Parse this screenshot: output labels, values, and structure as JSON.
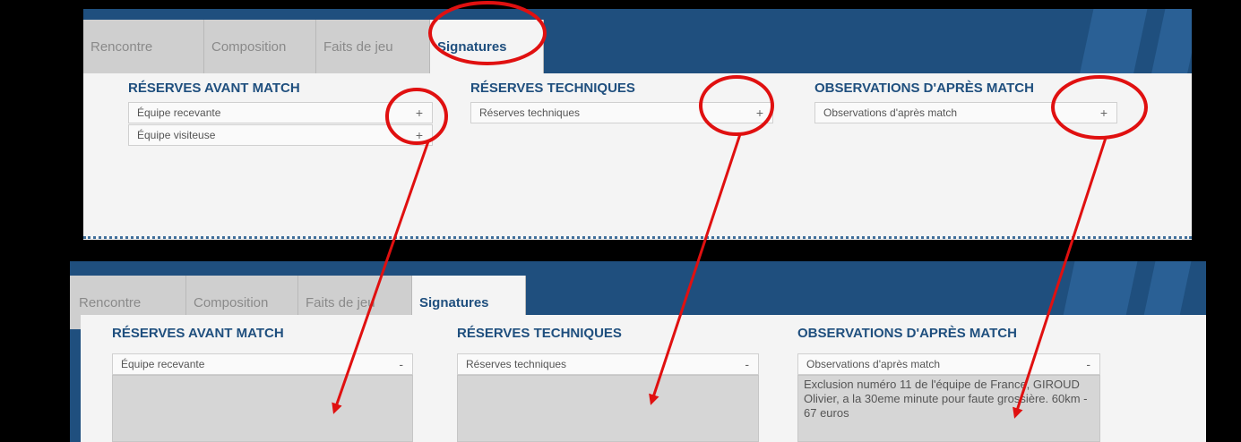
{
  "top": {
    "tabs": [
      "Rencontre",
      "Composition",
      "Faits de jeu",
      "Signatures"
    ],
    "sections": {
      "reserves_avant": {
        "title": "RÉSERVES AVANT MATCH",
        "rows": [
          {
            "label": "Équipe recevante",
            "toggle": "+"
          },
          {
            "label": "Équipe visiteuse",
            "toggle": "+"
          }
        ]
      },
      "reserves_tech": {
        "title": "RÉSERVES TECHNIQUES",
        "rows": [
          {
            "label": "Réserves techniques",
            "toggle": "+"
          }
        ]
      },
      "observations": {
        "title": "OBSERVATIONS D'APRÈS MATCH",
        "rows": [
          {
            "label": "Observations d'après match",
            "toggle": "+"
          }
        ]
      }
    }
  },
  "bottom": {
    "tabs": [
      "Rencontre",
      "Composition",
      "Faits de jeu",
      "Signatures"
    ],
    "sections": {
      "reserves_avant": {
        "title": "RÉSERVES AVANT MATCH",
        "row": {
          "label": "Équipe recevante",
          "toggle": "-"
        },
        "text": ""
      },
      "reserves_tech": {
        "title": "RÉSERVES TECHNIQUES",
        "row": {
          "label": "Réserves techniques",
          "toggle": "-"
        },
        "text": ""
      },
      "observations": {
        "title": "OBSERVATIONS D'APRÈS MATCH",
        "row": {
          "label": "Observations d'après match",
          "toggle": "-"
        },
        "text": "Exclusion numéro 11 de l'équipe de France, GIROUD Olivier, a la 30eme minute pour faute grossière. 60km - 67 euros"
      }
    }
  },
  "annotation_color": "#e01010"
}
